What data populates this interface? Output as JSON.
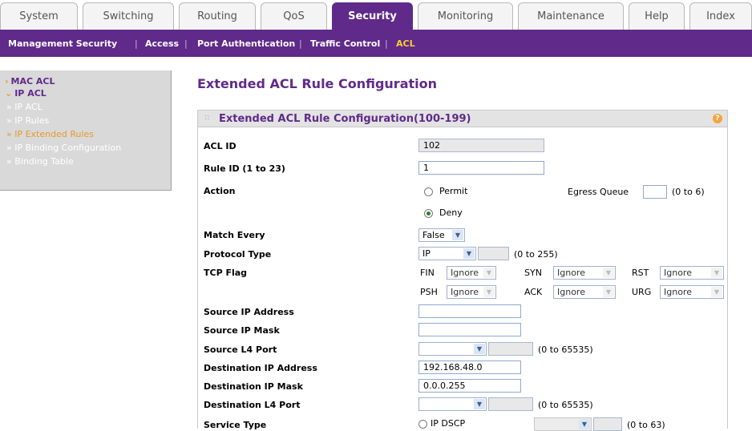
{
  "tabs": [
    "System",
    "Switching",
    "Routing",
    "QoS",
    "Security",
    "Monitoring",
    "Maintenance",
    "Help",
    "Index"
  ],
  "active_tab": "Security",
  "subnav": {
    "items": [
      "Management Security",
      "Access",
      "Port Authentication",
      "Traffic Control",
      "ACL"
    ],
    "separator": "|"
  },
  "sidebar": {
    "mac_acl": "MAC ACL",
    "ip_acl": "IP ACL",
    "items": [
      "» IP ACL",
      "» IP Rules",
      "» IP Extended Rules",
      "» IP Binding Configuration",
      "» Binding Table"
    ],
    "arrow_collapsed": "›",
    "arrow_expanded": "⌄"
  },
  "page_title": "Extended ACL Rule Configuration",
  "panel": {
    "title": "Extended ACL Rule Configuration(100-199)",
    "help": "?",
    "dots": "::"
  },
  "form": {
    "acl_id_label": "ACL ID",
    "acl_id_value": "102",
    "rule_id_label": "Rule ID (1 to 23)",
    "rule_id_value": "1",
    "action_label": "Action",
    "permit": "Permit",
    "deny": "Deny",
    "egress_label": "Egress Queue",
    "egress_range": "(0 to 6)",
    "match_every_label": "Match Every",
    "match_every_value": "False",
    "protocol_label": "Protocol Type",
    "protocol_value": "IP",
    "protocol_range": "(0 to 255)",
    "tcp_flag_label": "TCP Flag",
    "flags": {
      "fin": "FIN",
      "syn": "SYN",
      "rst": "RST",
      "psh": "PSH",
      "ack": "ACK",
      "urg": "URG",
      "value": "Ignore"
    },
    "src_ip_label": "Source IP Address",
    "src_mask_label": "Source IP Mask",
    "src_port_label": "Source L4 Port",
    "port_range": "(0 to 65535)",
    "dst_ip_label": "Destination IP Address",
    "dst_ip_value": "192.168.48.0",
    "dst_mask_label": "Destination IP Mask",
    "dst_mask_value": "0.0.0.255",
    "dst_port_label": "Destination L4 Port",
    "service_label": "Service Type",
    "ip_dscp": "IP DSCP",
    "dscp_range": "(0 to 63)"
  },
  "colors": {
    "brand": "#5f2a8a",
    "accent": "#e59a2c"
  }
}
